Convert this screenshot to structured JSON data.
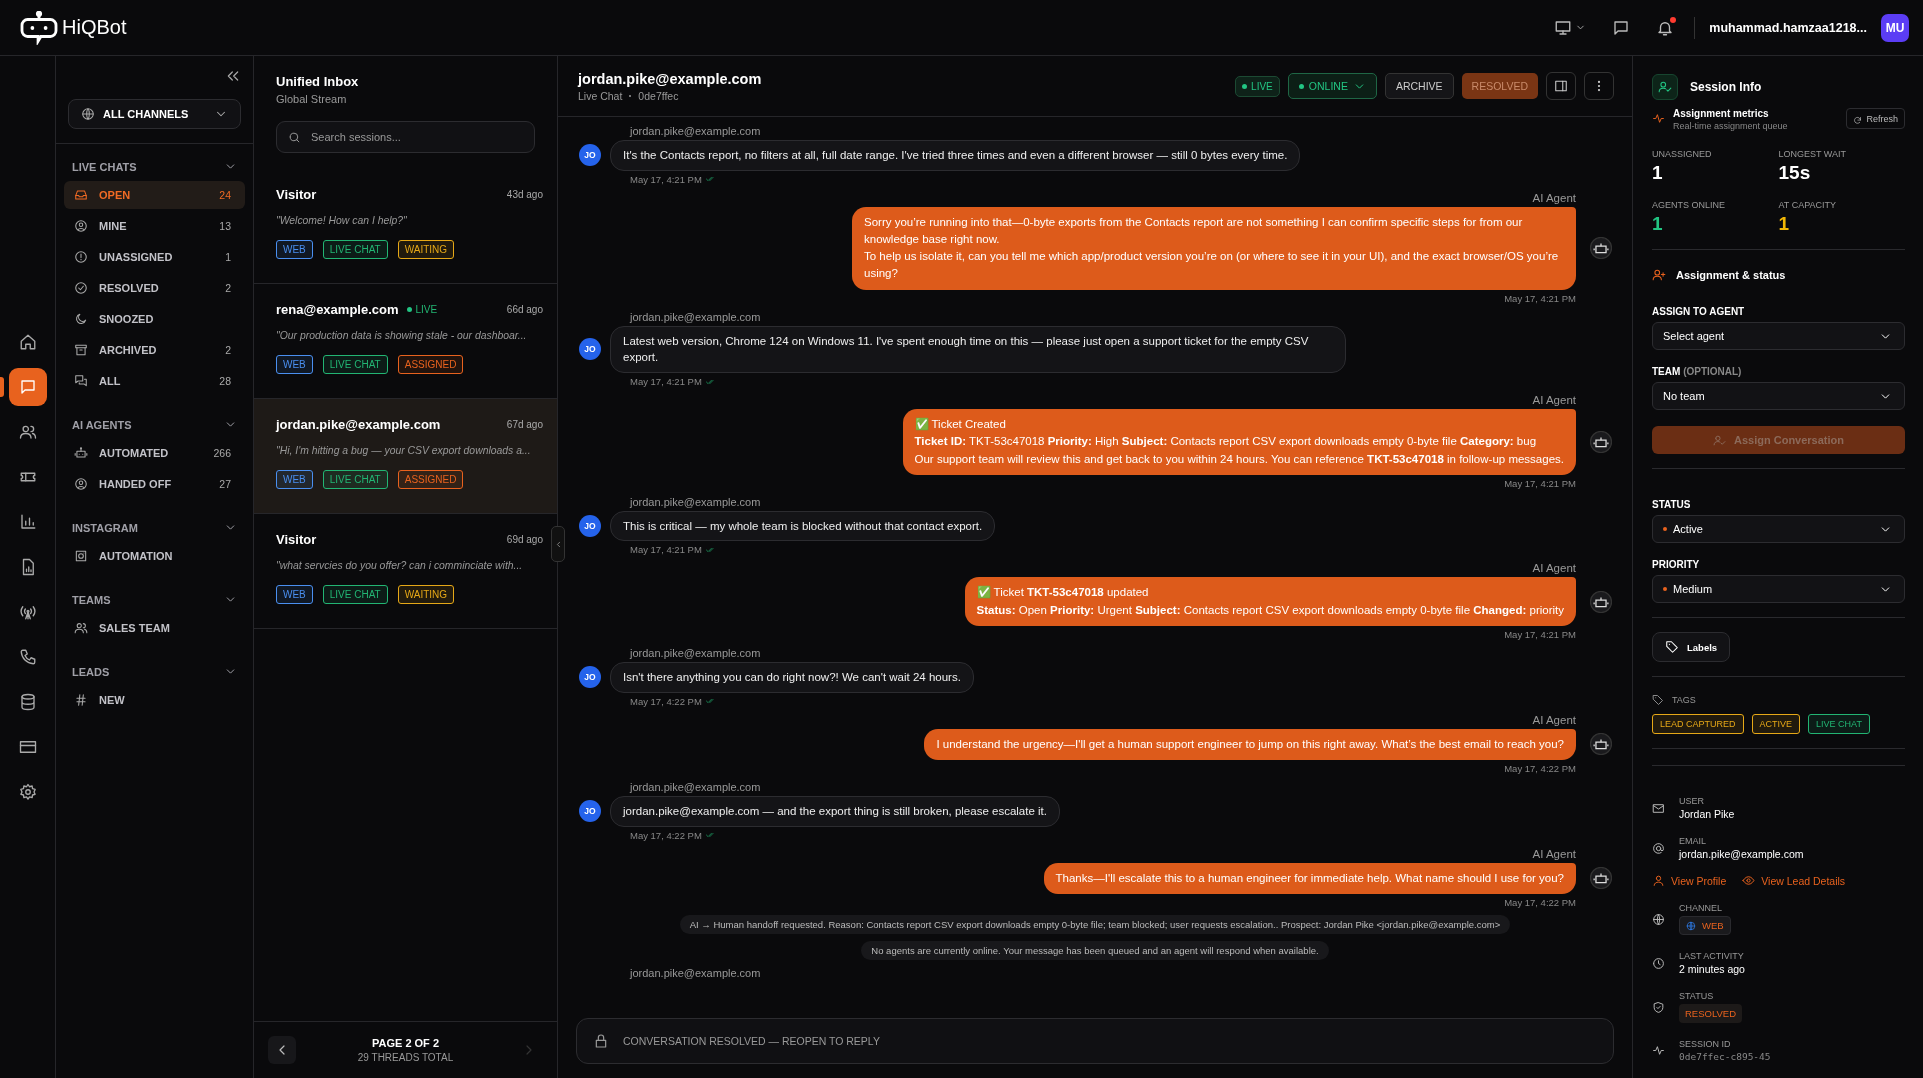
{
  "brand": "HiQBot",
  "topbar": {
    "user": "muhammad.hamzaa1218...",
    "avatar": "MU",
    "notification": true
  },
  "rail": [
    {
      "selected": false
    },
    {
      "selected": true
    },
    {
      "selected": false
    },
    {
      "selected": false
    },
    {
      "selected": false
    },
    {
      "selected": false
    },
    {
      "selected": false
    },
    {
      "selected": false
    },
    {
      "selected": false
    },
    {
      "selected": false
    },
    {
      "selected": false
    }
  ],
  "nav": {
    "channel_filter": "ALL CHANNELS",
    "sections": [
      {
        "title": "LIVE CHATS",
        "expanded": true,
        "items": [
          {
            "label": "OPEN",
            "count": "24",
            "selected": true
          },
          {
            "label": "MINE",
            "count": "13",
            "selected": false
          },
          {
            "label": "UNASSIGNED",
            "count": "1",
            "selected": false
          },
          {
            "label": "RESOLVED",
            "count": "2",
            "selected": false
          },
          {
            "label": "SNOOZED",
            "selected": false
          },
          {
            "label": "ARCHIVED",
            "count": "2",
            "selected": false
          },
          {
            "label": "ALL",
            "count": "28",
            "selected": false
          }
        ]
      },
      {
        "title": "AI AGENTS",
        "expanded": true,
        "items": [
          {
            "label": "AUTOMATED",
            "count": "266",
            "selected": false
          },
          {
            "label": "HANDED OFF",
            "count": "27",
            "selected": false
          }
        ]
      },
      {
        "title": "INSTAGRAM",
        "expanded": true,
        "items": [
          {
            "label": "AUTOMATION",
            "selected": false
          }
        ]
      },
      {
        "title": "TEAMS",
        "expanded": true,
        "items": [
          {
            "label": "SALES TEAM",
            "selected": false
          }
        ]
      },
      {
        "title": "LEADS",
        "expanded": true,
        "items": [
          {
            "label": "NEW",
            "selected": false
          }
        ]
      }
    ]
  },
  "inbox": {
    "title": "Unified Inbox",
    "subtitle": "Global Stream",
    "search": {
      "placeholder": "Search sessions..."
    },
    "sessions": [
      {
        "name": "Visitor",
        "time": "43d ago",
        "preview": "\"Welcome! How can I help?\"",
        "selected": false,
        "tags": [
          {
            "label": "WEB",
            "color": "#4a8ff0"
          },
          {
            "label": "LIVE CHAT",
            "color": "#22b573"
          },
          {
            "label": "WAITING",
            "color": "#e6a817"
          }
        ]
      },
      {
        "name": "rena@example.com",
        "badge": "LIVE",
        "time": "66d ago",
        "preview": "\"Our production data is showing stale - our dashboar...",
        "selected": false,
        "tags": [
          {
            "label": "WEB",
            "color": "#4a8ff0"
          },
          {
            "label": "LIVE CHAT",
            "color": "#22b573"
          },
          {
            "label": "ASSIGNED",
            "color": "#e8621e"
          }
        ]
      },
      {
        "name": "jordan.pike@example.com",
        "time": "67d ago",
        "preview": "\"Hi, I'm hitting a bug — your CSV export downloads a...",
        "selected": true,
        "tags": [
          {
            "label": "WEB",
            "color": "#4a8ff0"
          },
          {
            "label": "LIVE CHAT",
            "color": "#22b573"
          },
          {
            "label": "ASSIGNED",
            "color": "#e8621e"
          }
        ]
      },
      {
        "name": "Visitor",
        "time": "69d ago",
        "preview": "\"what servcies do you offer? can i comminciate with...",
        "selected": false,
        "tags": [
          {
            "label": "WEB",
            "color": "#4a8ff0"
          },
          {
            "label": "LIVE CHAT",
            "color": "#22b573"
          },
          {
            "label": "WAITING",
            "color": "#e6a817"
          }
        ]
      }
    ],
    "pager": {
      "page": "PAGE 2 OF 2",
      "total": "29 THREADS TOTAL",
      "prev_disabled": false,
      "next_disabled": true
    }
  },
  "chat": {
    "title": "jordan.pike@example.com",
    "channel": "Live Chat",
    "id": "0de7ffec",
    "live_badge": "LIVE",
    "presence": "ONLINE",
    "actions": [
      {
        "label": "ARCHIVE",
        "kind": "outline"
      },
      {
        "label": "RESOLVED",
        "kind": "status"
      }
    ],
    "messages": [
      {
        "kind": "user",
        "sender": "jordan.pike@example.com",
        "avatar": "JO",
        "lines": [
          "It's the Contacts report, no filters at all, full date range. I've tried three times and even a different browser — still 0 bytes every time."
        ],
        "time": "May 17, 4:21 PM",
        "read": true
      },
      {
        "kind": "agent",
        "sender": "AI Agent",
        "lines": [
          "Sorry you’re running into that—0-byte exports from the Contacts report are not something I can confirm specific steps for from our knowledge base right now.",
          "To help us isolate it, can you tell me which app/product version you’re on (or where to see it in your UI), and the exact browser/OS you’re using?"
        ],
        "time": "May 17, 4:21 PM"
      },
      {
        "kind": "user",
        "sender": "jordan.pike@example.com",
        "avatar": "JO",
        "lines": [
          "Latest web version, Chrome 124 on Windows 11. I've spent enough time on this — please just open a support ticket for the empty CSV export."
        ],
        "time": "May 17, 4:21 PM",
        "read": true
      },
      {
        "kind": "agent",
        "sender": "AI Agent",
        "lines": [
          "✅ Ticket Created",
          "**Ticket ID:** TKT-53c47018 **Priority:** High **Subject:** Contacts report CSV export downloads empty 0-byte file **Category:** bug",
          "Our support team will review this and get back to you within 24 hours. You can reference **TKT-53c47018** in follow-up messages."
        ],
        "time": "May 17, 4:21 PM"
      },
      {
        "kind": "user",
        "sender": "jordan.pike@example.com",
        "avatar": "JO",
        "lines": [
          "This is critical — my whole team is blocked without that contact export."
        ],
        "time": "May 17, 4:21 PM",
        "read": true
      },
      {
        "kind": "agent",
        "sender": "AI Agent",
        "lines": [
          "✅ Ticket **TKT-53c47018** updated",
          "**Status:** Open **Priority:** Urgent **Subject:** Contacts report CSV export downloads empty 0-byte file **Changed:** priority"
        ],
        "time": "May 17, 4:21 PM"
      },
      {
        "kind": "user",
        "sender": "jordan.pike@example.com",
        "avatar": "JO",
        "lines": [
          "Isn't there anything you can do right now?! We can't wait 24 hours."
        ],
        "time": "May 17, 4:22 PM",
        "read": true
      },
      {
        "kind": "agent",
        "sender": "AI Agent",
        "lines": [
          "I understand the urgency—I'll get a human support engineer to jump on this right away. What’s the best email to reach you?"
        ],
        "time": "May 17, 4:22 PM"
      },
      {
        "kind": "user",
        "sender": "jordan.pike@example.com",
        "avatar": "JO",
        "lines": [
          "jordan.pike@example.com — and the export thing is still broken, please escalate it."
        ],
        "time": "May 17, 4:22 PM",
        "read": true
      },
      {
        "kind": "agent",
        "sender": "AI Agent",
        "lines": [
          "Thanks—I'll escalate this to a human engineer for immediate help. What name should I use for you?"
        ],
        "time": "May 17, 4:22 PM"
      },
      {
        "kind": "system",
        "text": "AI → Human handoff requested. Reason: Contacts report CSV export downloads empty 0-byte file; team blocked; user requests escalation.. Prospect: Jordan Pike <jordan.pike@example.com>"
      },
      {
        "kind": "system",
        "text": "No agents are currently online. Your message has been queued and an agent will respond when available."
      },
      {
        "kind": "user",
        "sender": "jordan.pike@example.com"
      }
    ],
    "composer": {
      "text": "CONVERSATION RESOLVED — REOPEN TO REPLY",
      "locked": true
    }
  },
  "info": {
    "title": "Session Info",
    "metrics": {
      "title": "Assignment metrics",
      "subtitle": "Real-time assignment queue",
      "refresh": "Refresh",
      "stats": [
        {
          "label": "UNASSIGNED",
          "value": "1",
          "color": "#ffffff"
        },
        {
          "label": "LONGEST WAIT",
          "value": "15s",
          "color": "#ffffff"
        },
        {
          "label": "AGENTS ONLINE",
          "value": "1",
          "color": "#22c583"
        },
        {
          "label": "AT CAPACITY",
          "value": "1",
          "color": "#f2b705"
        }
      ]
    },
    "assignment": {
      "title": "Assignment & status",
      "agent_label": "ASSIGN TO AGENT",
      "agent_value": "Select agent",
      "team_label": "TEAM",
      "team_hint": "(OPTIONAL)",
      "team_value": "No team",
      "button": "Assign Conversation",
      "button_disabled": true
    },
    "status": {
      "label": "STATUS",
      "value": "Active",
      "color": "#e8621e"
    },
    "priority": {
      "label": "PRIORITY",
      "value": "Medium",
      "color": "#e8621e"
    },
    "labels_button": "Labels",
    "tags_title": "TAGS",
    "tags": [
      {
        "label": "LEAD CAPTURED",
        "color": "#e6a817"
      },
      {
        "label": "ACTIVE",
        "color": "#e6a817"
      },
      {
        "label": "LIVE CHAT",
        "color": "#22b573"
      }
    ],
    "details": [
      {
        "kind": "text",
        "label": "USER",
        "value": "Jordan Pike"
      },
      {
        "kind": "text",
        "label": "EMAIL",
        "value": "jordan.pike@example.com"
      }
    ],
    "links": [
      "View Profile",
      "View Lead Details"
    ],
    "details2": [
      {
        "kind": "channel",
        "label": "CHANNEL",
        "value": "WEB"
      },
      {
        "kind": "text",
        "label": "LAST ACTIVITY",
        "value": "2 minutes ago"
      },
      {
        "kind": "badge",
        "label": "STATUS",
        "value": "RESOLVED"
      },
      {
        "kind": "mono",
        "label": "SESSION ID",
        "value": "0de7ffec-c895-45"
      }
    ]
  }
}
